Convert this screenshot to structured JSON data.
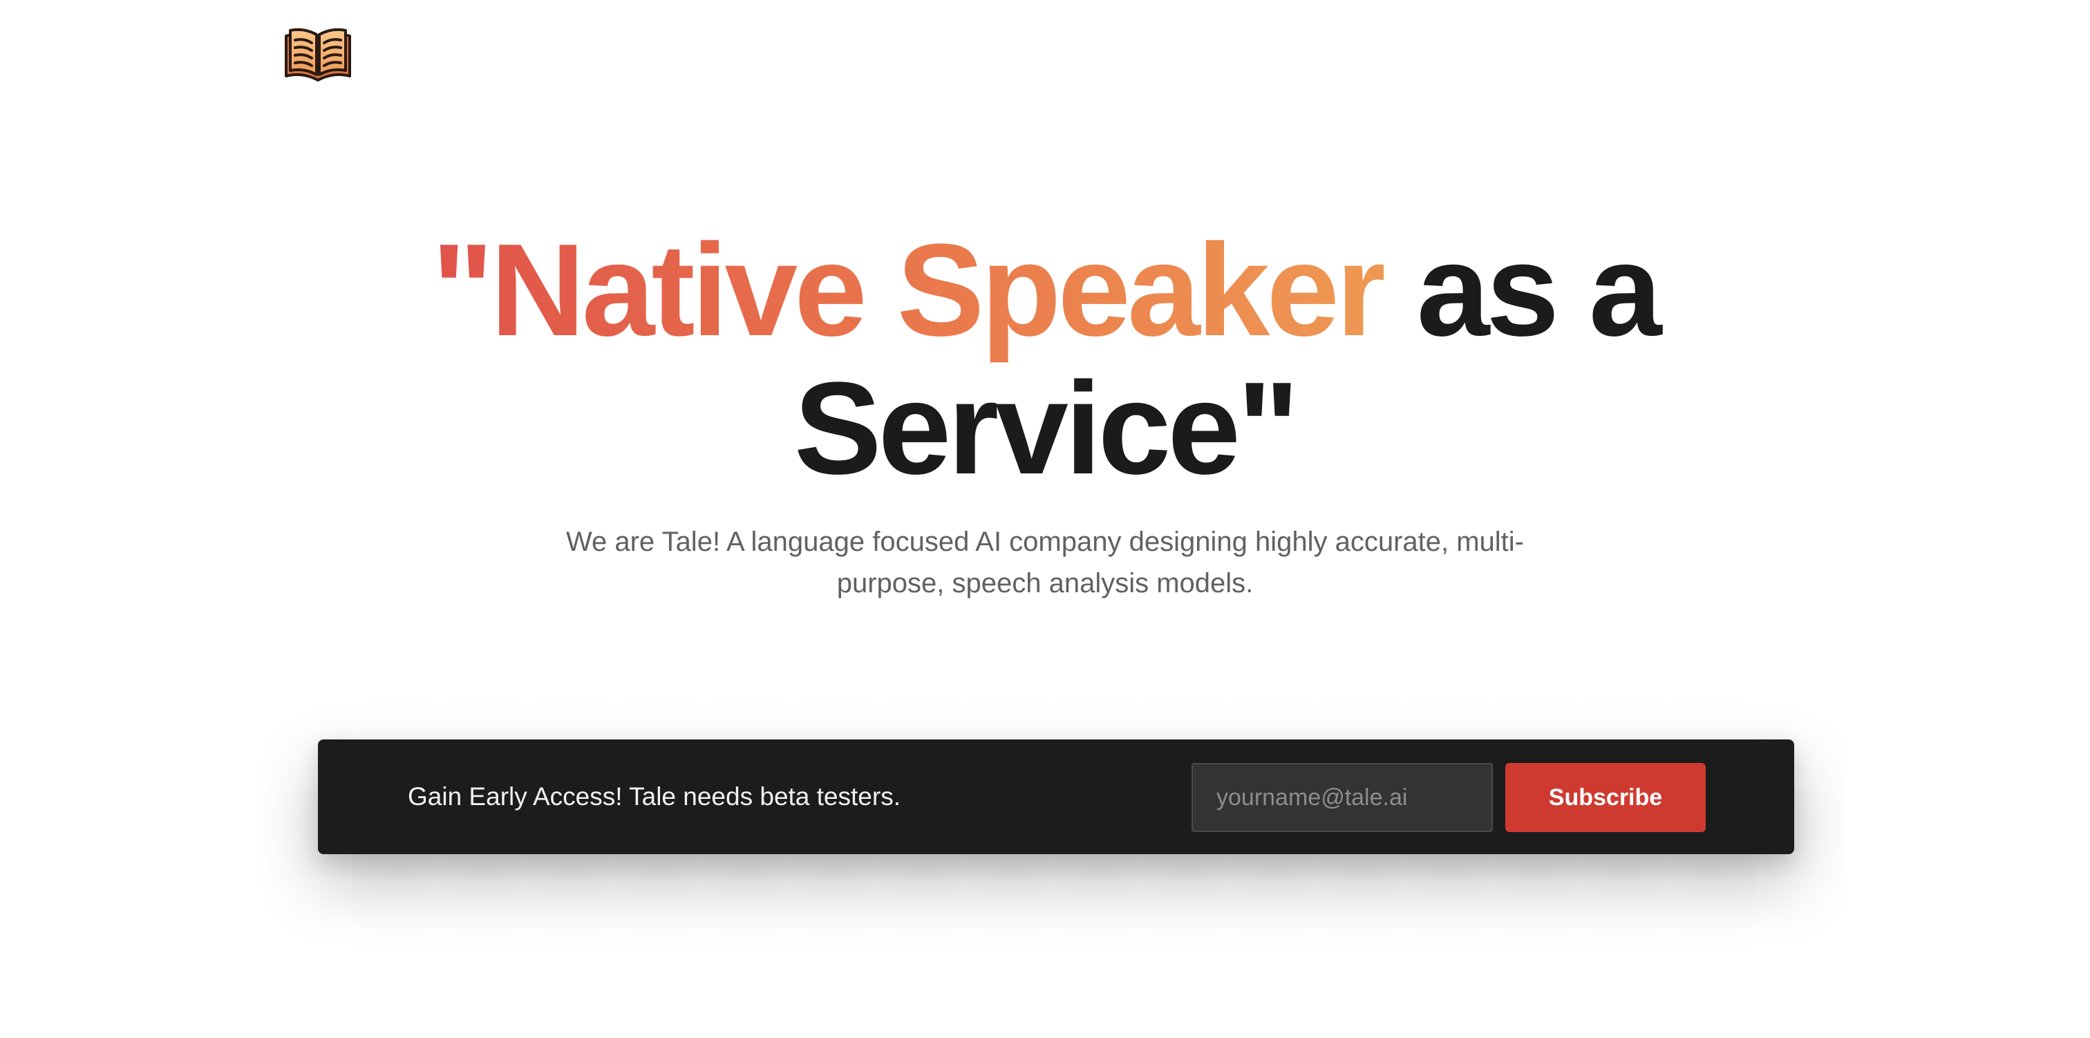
{
  "logo": {
    "icon": "open-book-icon"
  },
  "hero": {
    "headline_gradient": "\"Native Speaker",
    "headline_rest_line1": " as a",
    "headline_line2": "Service\"",
    "subtitle": "We are Tale! A language focused AI company designing highly accurate, multi-purpose, speech analysis models."
  },
  "cta": {
    "text": "Gain Early Access! Tale needs beta testers.",
    "email_placeholder": "yourname@tale.ai",
    "email_value": "",
    "subscribe_label": "Subscribe"
  },
  "colors": {
    "gradient_start": "#e0534a",
    "gradient_end": "#ee9953",
    "headline_dark": "#1b1b1b",
    "cta_background": "#1c1c1c",
    "subscribe_button": "#cf3a30"
  }
}
